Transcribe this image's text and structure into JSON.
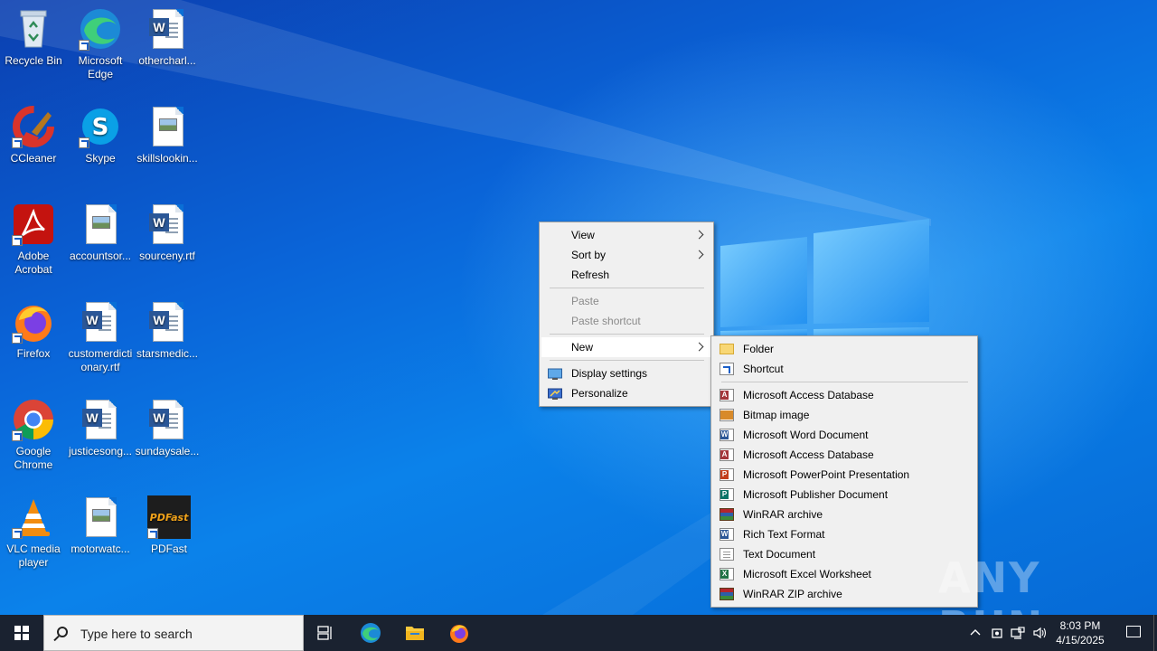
{
  "desktop": {
    "icons": [
      {
        "label": "Recycle Bin"
      },
      {
        "label": "Microsoft Edge"
      },
      {
        "label": "othercharl..."
      },
      {
        "label": "CCleaner"
      },
      {
        "label": "Skype"
      },
      {
        "label": "skillslookin..."
      },
      {
        "label": "Adobe Acrobat"
      },
      {
        "label": "accountsor..."
      },
      {
        "label": "sourceny.rtf"
      },
      {
        "label": "Firefox"
      },
      {
        "label": "customerdictionary.rtf"
      },
      {
        "label": "starsmedic..."
      },
      {
        "label": "Google Chrome"
      },
      {
        "label": "justicesong..."
      },
      {
        "label": "sundaysale..."
      },
      {
        "label": "VLC media player"
      },
      {
        "label": "motorwatc..."
      },
      {
        "label": "PDFast"
      }
    ]
  },
  "context_menu": {
    "items": [
      {
        "label": "View"
      },
      {
        "label": "Sort by"
      },
      {
        "label": "Refresh"
      },
      {
        "label": "Paste"
      },
      {
        "label": "Paste shortcut"
      },
      {
        "label": "New"
      },
      {
        "label": "Display settings"
      },
      {
        "label": "Personalize"
      }
    ]
  },
  "new_submenu": {
    "items": [
      {
        "label": "Folder"
      },
      {
        "label": "Shortcut"
      },
      {
        "label": "Microsoft Access Database"
      },
      {
        "label": "Bitmap image"
      },
      {
        "label": "Microsoft Word Document"
      },
      {
        "label": "Microsoft Access Database"
      },
      {
        "label": "Microsoft PowerPoint Presentation"
      },
      {
        "label": "Microsoft Publisher Document"
      },
      {
        "label": "WinRAR archive"
      },
      {
        "label": "Rich Text Format"
      },
      {
        "label": "Text Document"
      },
      {
        "label": "Microsoft Excel Worksheet"
      },
      {
        "label": "WinRAR ZIP archive"
      }
    ]
  },
  "taskbar": {
    "search_placeholder": "Type here to search",
    "clock_time": "8:03 PM",
    "clock_date": "4/15/2025"
  },
  "watermark": "ANY RUN",
  "colors": {
    "taskbar": "#1a2230",
    "menu_bg": "#f0f0f0",
    "wallpaper_blue": "#0a6fd6"
  }
}
